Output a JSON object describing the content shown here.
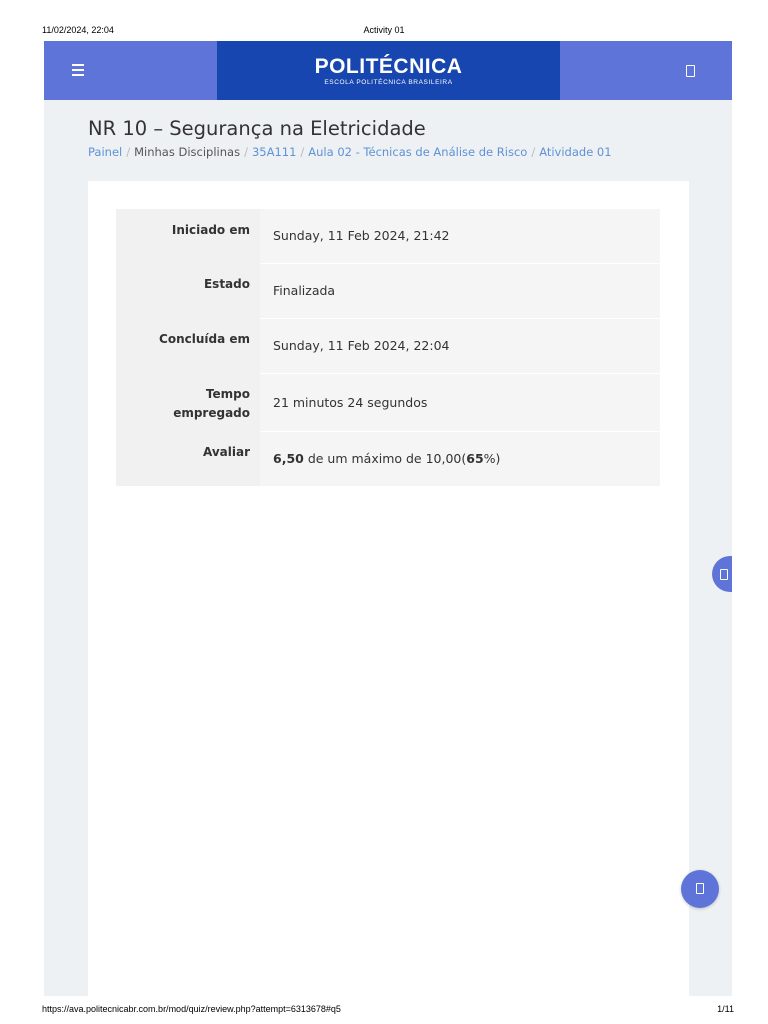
{
  "print_header": {
    "datetime": "11/02/2024, 22:04",
    "doc_title": "Activity 01"
  },
  "print_footer": {
    "url": "https://ava.politecnicabr.com.br/mod/quiz/review.php?attempt=6313678#q5",
    "page": "1/11"
  },
  "navbar": {
    "menu_icon": "hamburger-icon",
    "brand_name": "POLITÉCNICA",
    "brand_subtitle": "ESCOLA POLITÉCNICA BRASILEIRA",
    "right_icon": "square-icon",
    "color": "#5f74d9",
    "brand_color": "#1746b0"
  },
  "page_title": "NR 10 – Segurança na Eletricidade",
  "breadcrumb": [
    {
      "label": "Painel",
      "link": true
    },
    {
      "label": "Minhas Disciplinas",
      "link": false
    },
    {
      "label": "35A111",
      "link": true
    },
    {
      "label": "Aula 02 - Técnicas de Análise de Risco",
      "link": true
    },
    {
      "label": "Atividade 01",
      "link": true
    }
  ],
  "summary": {
    "started_label": "Iniciado em",
    "started_value": "Sunday, 11 Feb 2024, 21:42",
    "state_label": "Estado",
    "state_value": "Finalizada",
    "completed_label": "Concluída em",
    "completed_value": "Sunday, 11 Feb 2024, 22:04",
    "time_label_1": "Tempo",
    "time_label_2": "empregado",
    "time_value": "21 minutos 24 segundos",
    "grade_label": "Avaliar",
    "grade_score": "6,50",
    "grade_mid": " de um máximo de 10,00(",
    "grade_percent": "65",
    "grade_end": "%)"
  },
  "side_tab_icon": "square-icon",
  "fab_icon": "square-icon"
}
